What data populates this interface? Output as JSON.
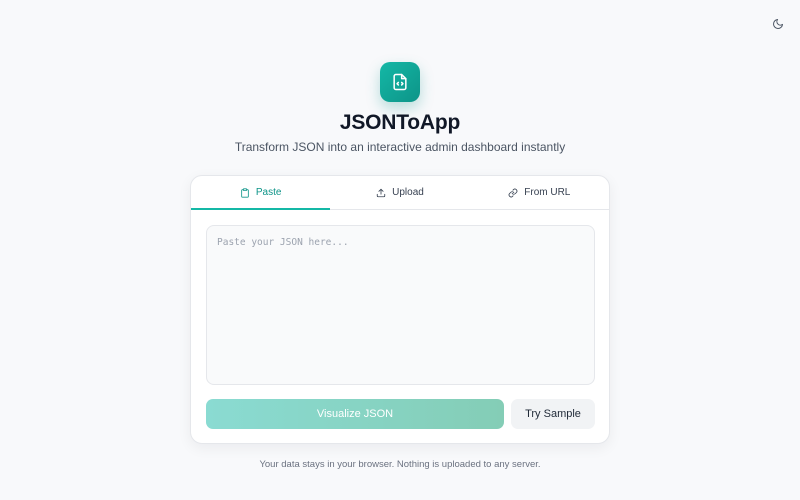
{
  "header": {
    "theme_toggle_icon": "moon-icon"
  },
  "brand": {
    "logo_icon": "file-code-icon",
    "title": "JSONToApp",
    "tagline": "Transform JSON into an interactive admin dashboard instantly",
    "accent_color": "#14b8a6"
  },
  "input_card": {
    "tabs": [
      {
        "label": "Paste",
        "icon": "clipboard-icon",
        "active": true
      },
      {
        "label": "Upload",
        "icon": "upload-icon",
        "active": false
      },
      {
        "label": "From URL",
        "icon": "link-icon",
        "active": false
      }
    ],
    "json_input": {
      "placeholder": "Paste your JSON here...",
      "value": ""
    },
    "visualize_label": "Visualize JSON",
    "sample_label": "Try Sample"
  },
  "footer": {
    "privacy_note": "Your data stays in your browser. Nothing is uploaded to any server."
  }
}
